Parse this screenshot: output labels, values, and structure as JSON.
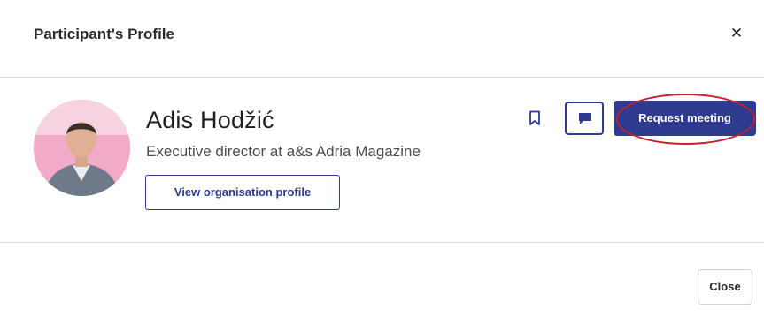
{
  "modal": {
    "title": "Participant's Profile",
    "close_icon": "close-icon"
  },
  "profile": {
    "name": "Adis Hodžić",
    "role": "Executive director at a&s Adria Magazine",
    "org_button_label": "View organisation profile",
    "bookmark_icon": "bookmark-icon",
    "chat_icon": "chat-bubble-icon",
    "request_meeting_label": "Request meeting"
  },
  "footer": {
    "close_label": "Close"
  },
  "colors": {
    "primary": "#2e3b8e",
    "annotation": "#c4202a",
    "avatar_bg": "#ee9fbf"
  }
}
